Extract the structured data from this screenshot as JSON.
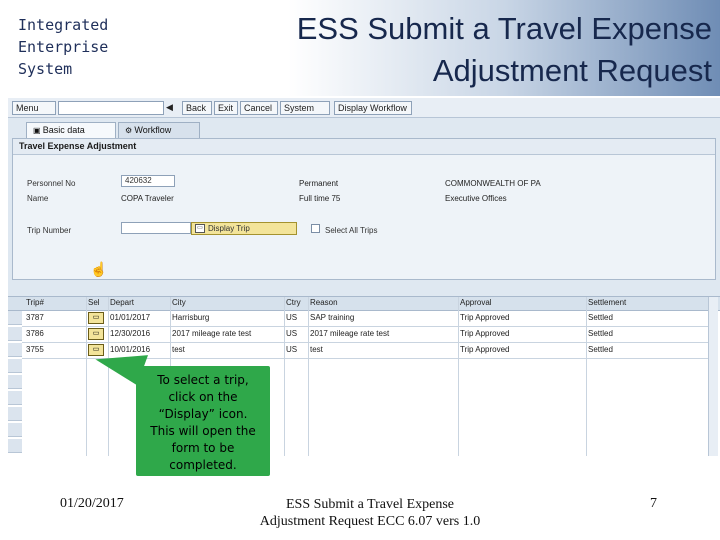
{
  "brand": {
    "line1": "Integrated",
    "line2": "Enterprise",
    "line3": "System"
  },
  "slide": {
    "title_line1": "ESS Submit a Travel Expense",
    "title_line2": "Adjustment Request"
  },
  "toolbar": {
    "menu": "Menu",
    "back": "Back",
    "exit": "Exit",
    "cancel": "Cancel",
    "system": "System",
    "display_workflow": "Display Workflow"
  },
  "tabs": {
    "basic_data": "Basic data",
    "workflow": "Workflow"
  },
  "panel": {
    "title": "Travel Expense Adjustment",
    "personnel_no_label": "Personnel No",
    "personnel_no_value": "420632",
    "name_label": "Name",
    "name_value": "COPA Traveler",
    "permanent_label": "Permanent",
    "fulltime_label": "Full time 75",
    "commonwealth_label": "COMMONWEALTH OF PA",
    "exec_offices_label": "Executive Offices",
    "trip_number_label": "Trip Number",
    "display_trip_button": "Display Trip",
    "select_all_trips_label": "Select All Trips"
  },
  "grid": {
    "headers": {
      "trip": "Trip#",
      "sel": "Sel",
      "depart": "Depart",
      "city": "City",
      "ctry": "Ctry",
      "reason": "Reason",
      "approval": "Approval",
      "settlement": "Settlement"
    },
    "rows": [
      {
        "trip": "3787",
        "depart": "01/01/2017",
        "city": "Harrisburg",
        "ctry": "US",
        "reason": "SAP training",
        "approval": "Trip Approved",
        "settlement": "Settled"
      },
      {
        "trip": "3786",
        "depart": "12/30/2016",
        "city": "2017 mileage rate test",
        "ctry": "US",
        "reason": "2017 mileage rate test",
        "approval": "Trip Approved",
        "settlement": "Settled"
      },
      {
        "trip": "3755",
        "depart": "10/01/2016",
        "city": "test",
        "ctry": "US",
        "reason": "test",
        "approval": "Trip Approved",
        "settlement": "Settled"
      }
    ]
  },
  "callout": {
    "line1": "To select a trip,",
    "line2": "click on the",
    "line3": "“Display” icon.",
    "line4": "This will open the",
    "line5": "form to be",
    "line6": "completed."
  },
  "footer": {
    "date": "01/20/2017",
    "title_line1": "ESS Submit a Travel Expense",
    "title_line2": "Adjustment Request ECC 6.07 vers 1.0",
    "page": "7"
  },
  "colors": {
    "callout": "#2fa84a",
    "title": "#17284d",
    "sap_bg": "#dfe8f1"
  }
}
